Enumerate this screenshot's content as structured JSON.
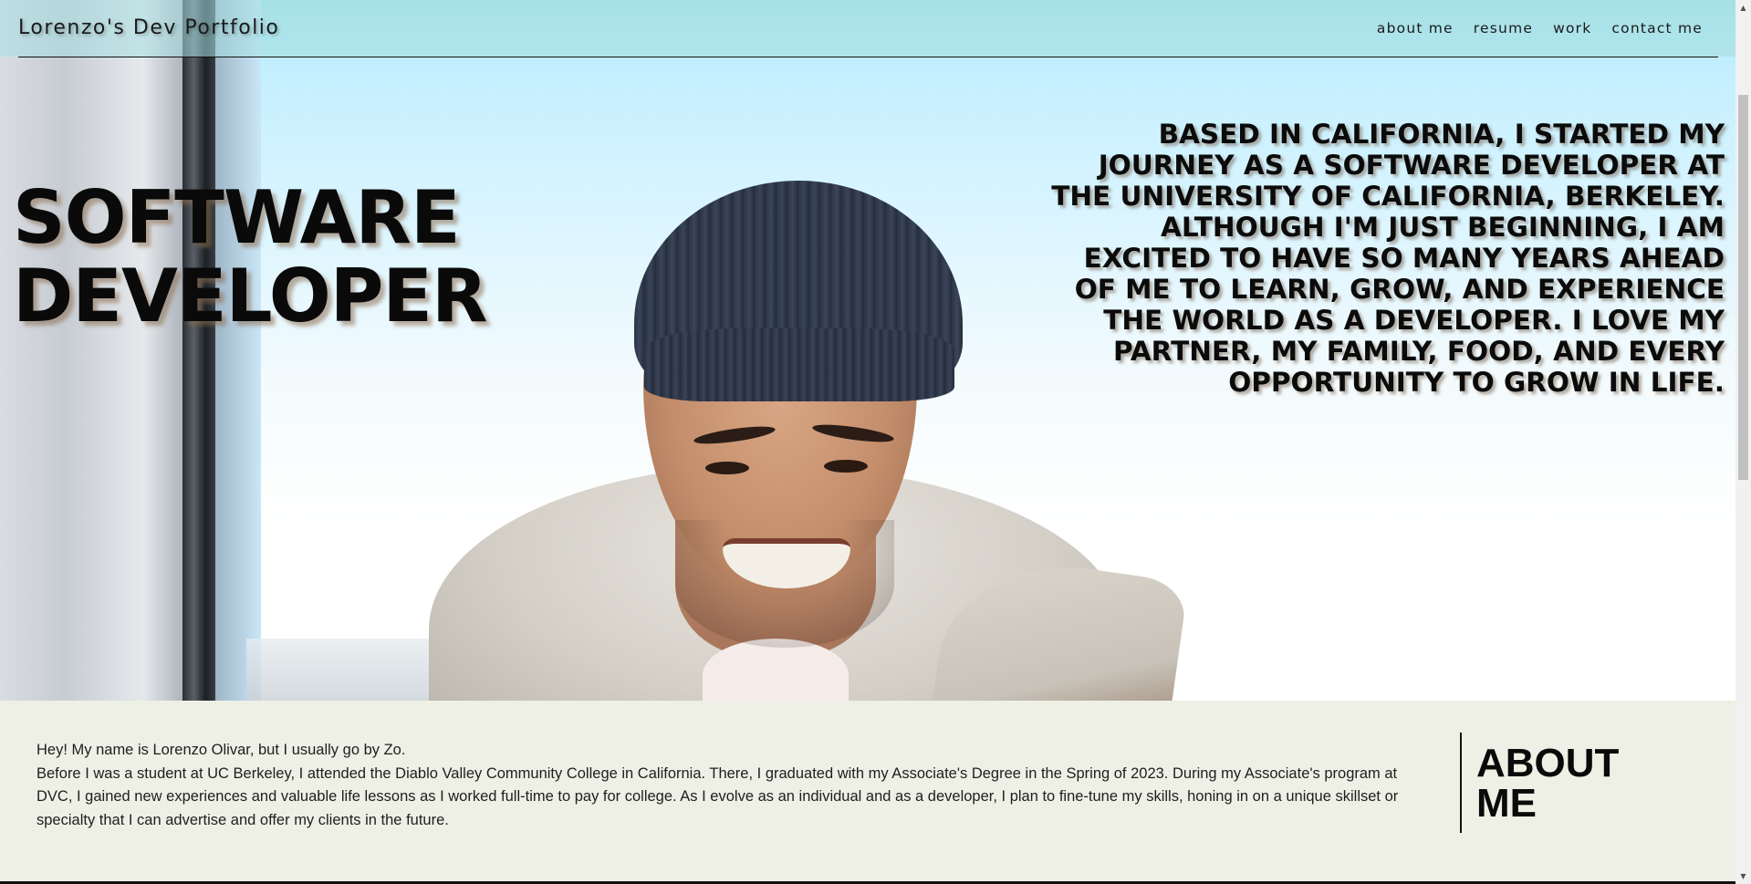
{
  "nav": {
    "brand": "Lorenzo's Dev Portfolio",
    "links": [
      "about me",
      "resume",
      "work",
      "contact me"
    ]
  },
  "hero": {
    "title_line1": "SOFTWARE",
    "title_line2": "DEVELOPER",
    "blurb": "Based in California, I started my journey as a software developer at the University of California, Berkeley. Although I'm just beginning, I am excited to have so many years ahead of me to learn, grow, and experience the world as a developer. I love my partner, my family, food, and every opportunity to grow in life."
  },
  "about": {
    "heading_line1": "ABOUT",
    "heading_line2": "ME",
    "intro": "Hey! My name is Lorenzo Olivar, but I usually go by Zo.",
    "body": "Before I was a student at UC Berkeley, I attended the Diablo Valley Community College in California. There, I graduated with my Associate's Degree in the Spring of 2023. During my Associate's program at DVC, I gained new experiences and valuable life lessons as I worked full-time to pay for college. As I evolve as an individual and as a developer, I plan to fine-tune my skills, honing in on a unique skillset or specialty that I can advertise and offer my clients in the future."
  },
  "colors": {
    "nav_bg": "#a6dee2",
    "about_bg": "#eff0e5",
    "text": "#0a0a0a"
  },
  "icons": {
    "scroll_up": "▲",
    "scroll_down": "▼"
  }
}
